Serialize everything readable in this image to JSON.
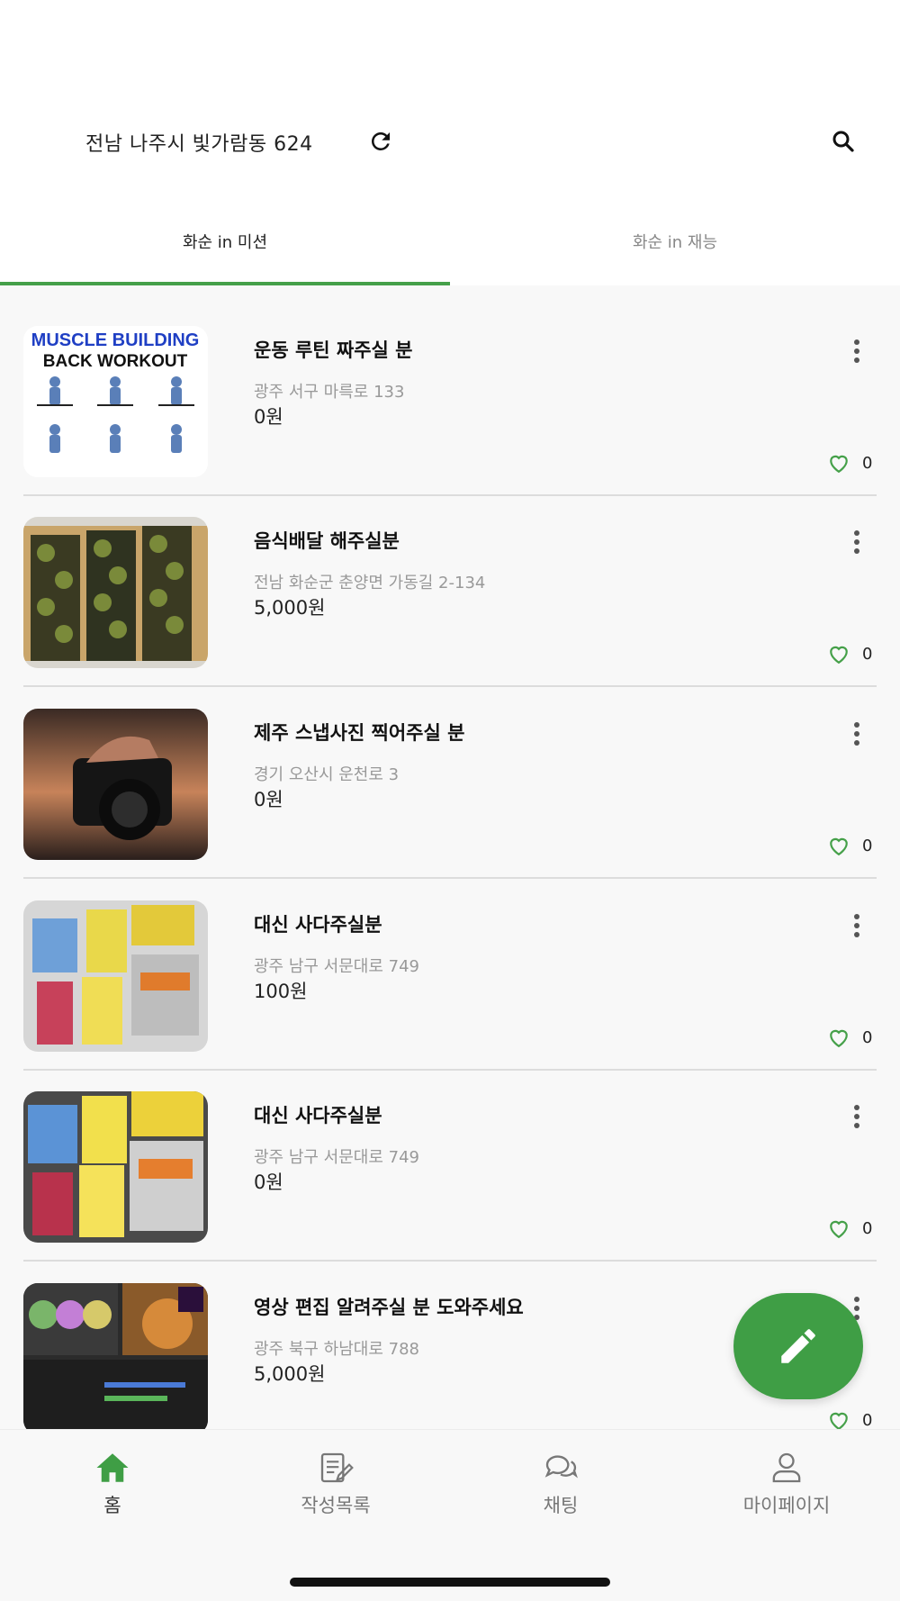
{
  "header": {
    "location": "전남 나주시 빛가람동 624",
    "refresh_icon": "refresh-icon",
    "search_icon": "search-icon"
  },
  "tabs": [
    {
      "label": "화순 in 미션",
      "active": true
    },
    {
      "label": "화순 in 재능",
      "active": false
    }
  ],
  "items": [
    {
      "title": "운동 루틴 짜주실 분",
      "address": "광주 서구 마륵로 133",
      "price": "0원",
      "likes": "0",
      "thumb_text_1": "MUSCLE BUILDING",
      "thumb_text_2": "BACK WORKOUT"
    },
    {
      "title": "음식배달 해주실분",
      "address": "전남 화순군 춘양면 가동길 2-134",
      "price": "5,000원",
      "likes": "0"
    },
    {
      "title": "제주 스냅사진 찍어주실 분",
      "address": "경기 오산시 운천로 3",
      "price": "0원",
      "likes": "0"
    },
    {
      "title": "대신 사다주실분",
      "address": "광주 남구 서문대로 749",
      "price": "100원",
      "likes": "0"
    },
    {
      "title": "대신 사다주실분",
      "address": "광주 남구 서문대로 749",
      "price": "0원",
      "likes": "0"
    },
    {
      "title": "영상 편집 알려주실 분 도와주세요",
      "address": "광주 북구 하남대로 788",
      "price": "5,000원",
      "likes": "0"
    }
  ],
  "fab": {
    "icon": "pencil-icon"
  },
  "bottom_nav": [
    {
      "label": "홈",
      "icon": "home-icon",
      "active": true
    },
    {
      "label": "작성목록",
      "icon": "document-edit-icon",
      "active": false
    },
    {
      "label": "채팅",
      "icon": "chat-icon",
      "active": false
    },
    {
      "label": "마이페이지",
      "icon": "person-icon",
      "active": false
    }
  ],
  "colors": {
    "accent": "#45a049",
    "fab": "#3f9e45",
    "background": "#f8f8f8"
  }
}
